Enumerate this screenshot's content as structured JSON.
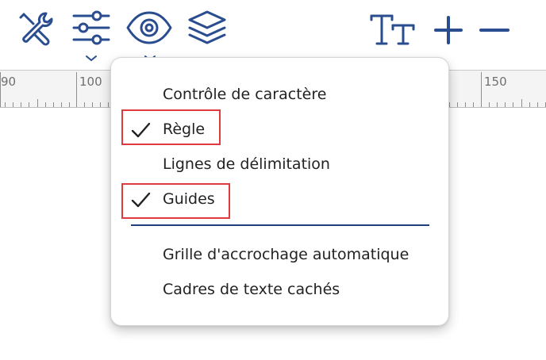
{
  "toolbar": {
    "icons": [
      "tools-icon",
      "sliders-icon",
      "eye-icon",
      "layers-icon",
      "text-size-icon",
      "zoom-in-icon",
      "zoom-out-icon"
    ],
    "icon_color": "#2a4d8f"
  },
  "ruler": {
    "labels": [
      "90",
      "100",
      "150"
    ],
    "label_color": "#6f6f6f"
  },
  "view_menu": {
    "items": [
      {
        "label": "Contrôle de caractère",
        "checked": false
      },
      {
        "label": "Règle",
        "checked": true,
        "highlighted": true
      },
      {
        "label": "Lignes de délimitation",
        "checked": false
      },
      {
        "label": "Guides",
        "checked": true,
        "highlighted": true
      },
      {
        "label": "Grille d'accrochage automatique",
        "checked": false
      },
      {
        "label": "Cadres de texte cachés",
        "checked": false
      }
    ],
    "divider_color": "#1f3f7a",
    "highlight_color": "#e0393e"
  }
}
